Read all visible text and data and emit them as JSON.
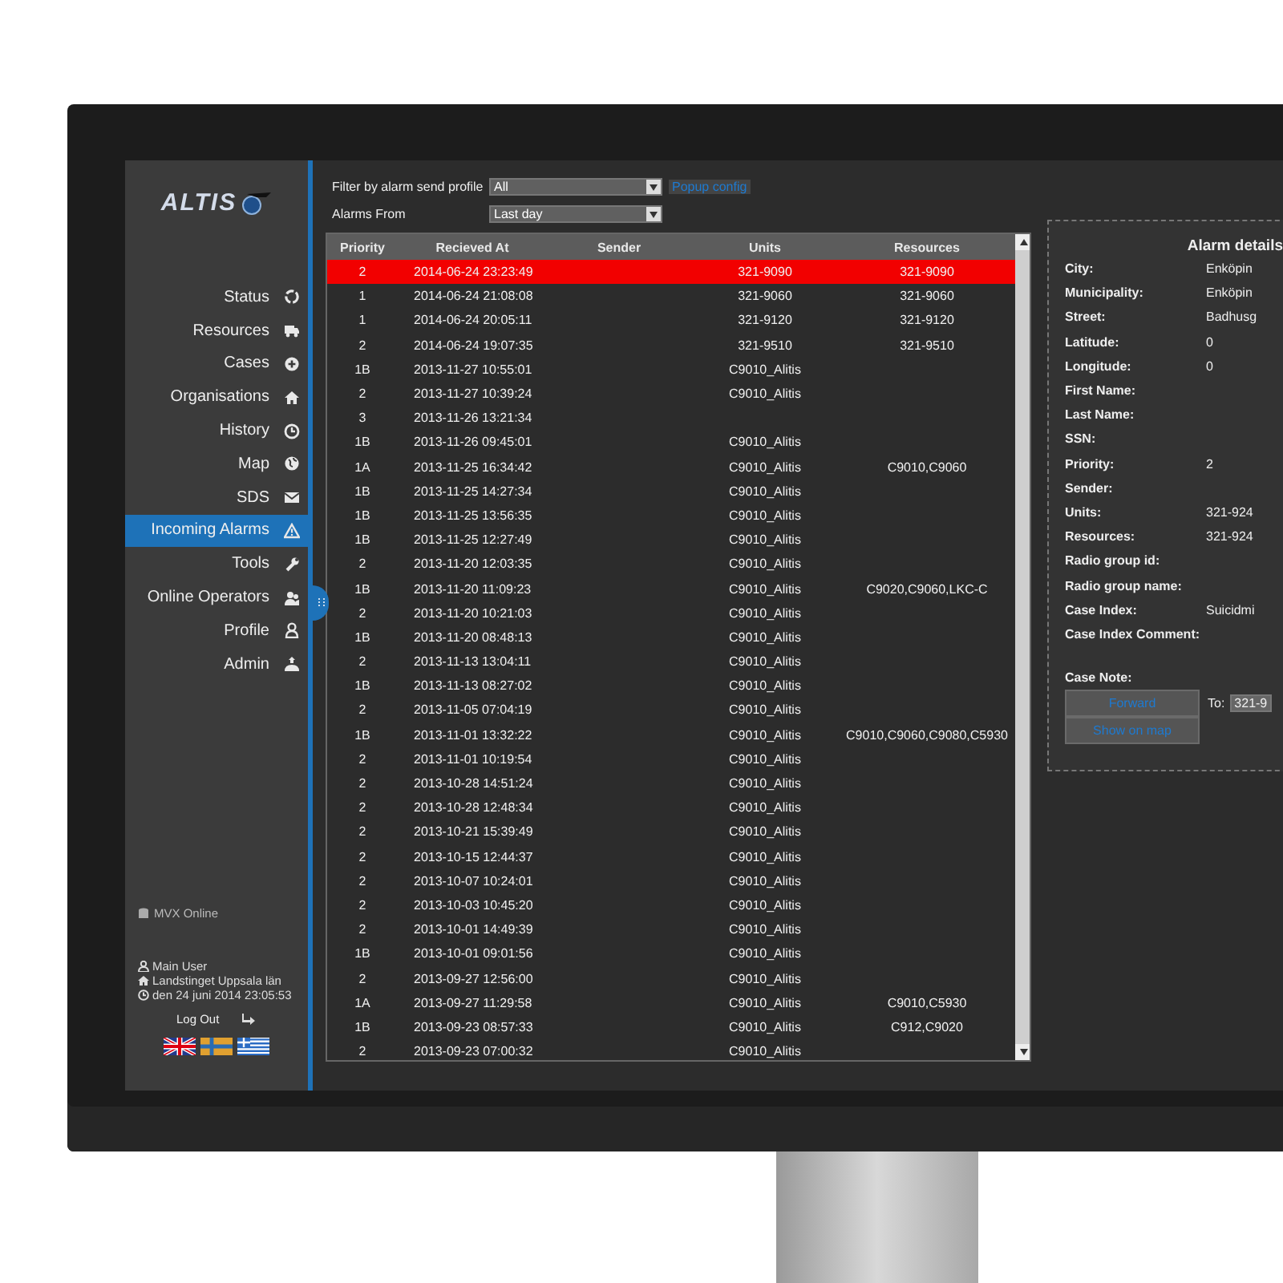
{
  "logo": "ALTIS",
  "nav": [
    {
      "label": "Status",
      "selected": false
    },
    {
      "label": "Resources",
      "selected": false
    },
    {
      "label": "Cases",
      "selected": false
    },
    {
      "label": "Organisations",
      "selected": false
    },
    {
      "label": "History",
      "selected": false
    },
    {
      "label": "Map",
      "selected": false
    },
    {
      "label": "SDS",
      "selected": false
    },
    {
      "label": "Incoming Alarms",
      "selected": true
    },
    {
      "label": "Tools",
      "selected": false
    },
    {
      "label": "Online Operators",
      "selected": false
    },
    {
      "label": "Profile",
      "selected": false
    },
    {
      "label": "Admin",
      "selected": false
    }
  ],
  "connection": "MVX Online",
  "user": {
    "name": "Main User",
    "org": "Landstinget Uppsala län",
    "time": "den 24 juni 2014 23:05:53"
  },
  "logout": "Log Out",
  "filters": [
    {
      "label": "Filter by alarm send profile",
      "value": "All"
    },
    {
      "label": "Alarms From",
      "value": "Last day"
    }
  ],
  "popup_link": "Popup config",
  "table": {
    "columns": [
      "Priority",
      "Recieved At",
      "Sender",
      "Units",
      "Resources"
    ],
    "rows": [
      {
        "priority": "2",
        "received_at": "2014-06-24 23:23:49",
        "units": "321-9090",
        "resources": "321-9090",
        "selected": true
      },
      {
        "priority": "1",
        "received_at": "2014-06-24 21:08:08",
        "units": "321-9060",
        "resources": "321-9060",
        "selected": false
      },
      {
        "priority": "1",
        "received_at": "2014-06-24 20:05:11",
        "units": "321-9120",
        "resources": "321-9120",
        "selected": false
      },
      {
        "priority": "2",
        "received_at": "2014-06-24 19:07:35",
        "units": "321-9510",
        "resources": "321-9510",
        "selected": false
      },
      {
        "priority": "1B",
        "received_at": "2013-11-27 10:55:01",
        "units": "C9010_Alitis",
        "selected": false
      },
      {
        "priority": "2",
        "received_at": "2013-11-27 10:39:24",
        "units": "C9010_Alitis",
        "selected": false
      },
      {
        "priority": "3",
        "received_at": "2013-11-26 13:21:34",
        "selected": false
      },
      {
        "priority": "1B",
        "received_at": "2013-11-26 09:45:01",
        "units": "C9010_Alitis",
        "selected": false
      },
      {
        "priority": "1A",
        "received_at": "2013-11-25 16:34:42",
        "units": "C9010_Alitis",
        "resources": "C9010,C9060",
        "selected": false
      },
      {
        "priority": "1B",
        "received_at": "2013-11-25 14:27:34",
        "units": "C9010_Alitis",
        "selected": false
      },
      {
        "priority": "1B",
        "received_at": "2013-11-25 13:56:35",
        "units": "C9010_Alitis",
        "selected": false
      },
      {
        "priority": "1B",
        "received_at": "2013-11-25 12:27:49",
        "units": "C9010_Alitis",
        "selected": false
      },
      {
        "priority": "2",
        "received_at": "2013-11-20 12:03:35",
        "units": "C9010_Alitis",
        "selected": false
      },
      {
        "priority": "1B",
        "received_at": "2013-11-20 11:09:23",
        "units": "C9010_Alitis",
        "resources": "C9020,C9060,LKC-C",
        "selected": false
      },
      {
        "priority": "2",
        "received_at": "2013-11-20 10:21:03",
        "units": "C9010_Alitis",
        "selected": false
      },
      {
        "priority": "1B",
        "received_at": "2013-11-20 08:48:13",
        "units": "C9010_Alitis",
        "selected": false
      },
      {
        "priority": "2",
        "received_at": "2013-11-13 13:04:11",
        "units": "C9010_Alitis",
        "selected": false
      },
      {
        "priority": "1B",
        "received_at": "2013-11-13 08:27:02",
        "units": "C9010_Alitis",
        "selected": false
      },
      {
        "priority": "2",
        "received_at": "2013-11-05 07:04:19",
        "units": "C9010_Alitis",
        "selected": false
      },
      {
        "priority": "1B",
        "received_at": "2013-11-01 13:32:22",
        "units": "C9010_Alitis",
        "resources": "C9010,C9060,C9080,C5930",
        "selected": false
      },
      {
        "priority": "2",
        "received_at": "2013-11-01 10:19:54",
        "units": "C9010_Alitis",
        "selected": false
      },
      {
        "priority": "2",
        "received_at": "2013-10-28 14:51:24",
        "units": "C9010_Alitis",
        "selected": false
      },
      {
        "priority": "2",
        "received_at": "2013-10-28 12:48:34",
        "units": "C9010_Alitis",
        "selected": false
      },
      {
        "priority": "2",
        "received_at": "2013-10-21 15:39:49",
        "units": "C9010_Alitis",
        "selected": false
      },
      {
        "priority": "2",
        "received_at": "2013-10-15 12:44:37",
        "units": "C9010_Alitis",
        "selected": false
      },
      {
        "priority": "2",
        "received_at": "2013-10-07 10:24:01",
        "units": "C9010_Alitis",
        "selected": false
      },
      {
        "priority": "2",
        "received_at": "2013-10-03 10:45:20",
        "units": "C9010_Alitis",
        "selected": false
      },
      {
        "priority": "2",
        "received_at": "2013-10-01 14:49:39",
        "units": "C9010_Alitis",
        "selected": false
      },
      {
        "priority": "1B",
        "received_at": "2013-10-01 09:01:56",
        "units": "C9010_Alitis",
        "selected": false
      },
      {
        "priority": "2",
        "received_at": "2013-09-27 12:56:00",
        "units": "C9010_Alitis",
        "selected": false
      },
      {
        "priority": "1A",
        "received_at": "2013-09-27 11:29:58",
        "units": "C9010_Alitis",
        "resources": "C9010,C5930",
        "selected": false
      },
      {
        "priority": "1B",
        "received_at": "2013-09-23 08:57:33",
        "units": "C9010_Alitis",
        "resources": "C912,C9020",
        "selected": false
      },
      {
        "priority": "2",
        "received_at": "2013-09-23 07:00:32",
        "units": "C9010_Alitis",
        "selected": false
      }
    ]
  },
  "details": {
    "title": "Alarm details",
    "fields": [
      {
        "label": "City:",
        "value": "Enköpin"
      },
      {
        "label": "Municipality:",
        "value": "Enköpin"
      },
      {
        "label": "Street:",
        "value": "Badhusg"
      },
      {
        "label": "Latitude:",
        "value": "0"
      },
      {
        "label": "Longitude:",
        "value": "0"
      },
      {
        "label": "First Name:"
      },
      {
        "label": "Last Name:"
      },
      {
        "label": "SSN:"
      },
      {
        "label": "Priority:",
        "value": "2"
      },
      {
        "label": "Sender:"
      },
      {
        "label": "Units:",
        "value": "321-924"
      },
      {
        "label": "Resources:",
        "value": "321-924"
      },
      {
        "label": "Radio group id:"
      },
      {
        "label": "Radio group name:"
      },
      {
        "label": "Case Index:",
        "value": "Suicidmi"
      },
      {
        "label": "Case Index Comment:"
      }
    ],
    "note_label": "Case Note:",
    "buttons": [
      "Forward",
      "Show on map"
    ],
    "to_label": "To:",
    "to_value": "321-9"
  }
}
